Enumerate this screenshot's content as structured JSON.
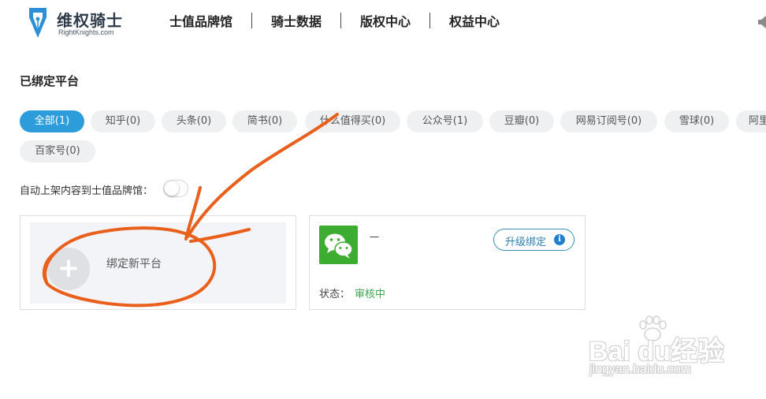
{
  "header": {
    "brand_name": "维权骑士",
    "brand_sub": "RightKnights.com",
    "nav": [
      "士值品牌馆",
      "骑士数据",
      "版权中心",
      "权益中心"
    ]
  },
  "section": {
    "title": "已绑定平台"
  },
  "tabs": [
    {
      "label": "全部(1)",
      "active": true
    },
    {
      "label": "知乎(0)",
      "active": false
    },
    {
      "label": "头条(0)",
      "active": false
    },
    {
      "label": "简书(0)",
      "active": false
    },
    {
      "label": "什么值得买(0)",
      "active": false
    },
    {
      "label": "公众号(1)",
      "active": false
    },
    {
      "label": "豆瓣(0)",
      "active": false
    },
    {
      "label": "网易订阅号(0)",
      "active": false
    },
    {
      "label": "雪球(0)",
      "active": false
    },
    {
      "label": "阿里",
      "active": false
    },
    {
      "label": "百家号(0)",
      "active": false
    }
  ],
  "auto_publish": {
    "label": "自动上架内容到士值品牌馆：",
    "enabled": false
  },
  "add_card": {
    "label": "绑定新平台"
  },
  "account_card": {
    "name": "一",
    "upgrade_label": "升级绑定",
    "info_glyph": "i",
    "status_label": "状态：",
    "status_value": "审核中",
    "platform_icon": "wechat-icon"
  },
  "watermark": {
    "brand": "Bai  du经验",
    "url": "jingyan.baidu.com"
  },
  "colors": {
    "accent": "#2d9cdb",
    "wechat_green": "#3dad31",
    "status_green": "#3aa54a",
    "annotation": "#e8601c"
  }
}
